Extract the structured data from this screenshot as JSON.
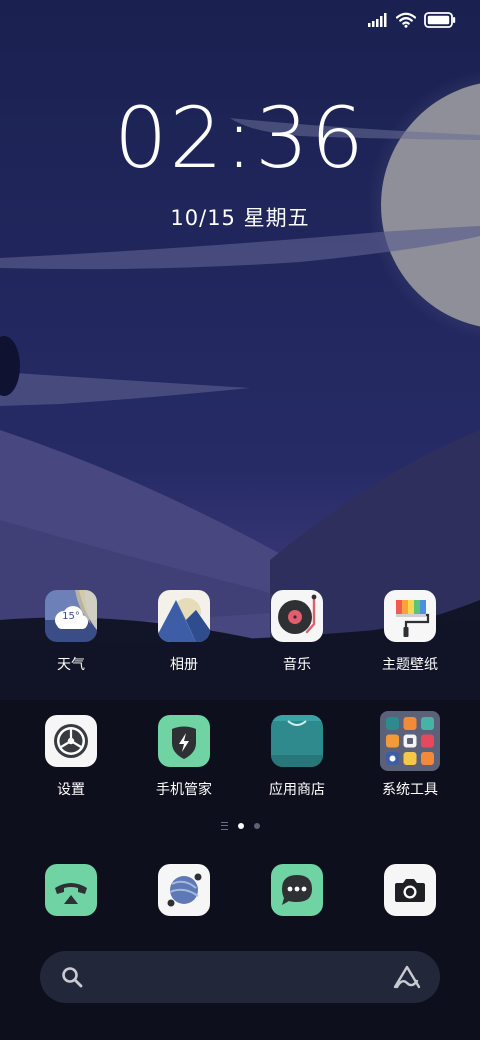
{
  "status_bar": {
    "signal_icon": "signal-bars-icon",
    "wifi_icon": "wifi-icon",
    "battery_icon": "battery-icon"
  },
  "clock": {
    "time": "02:36",
    "date": "10/15 星期五"
  },
  "home_apps": [
    {
      "label": "天气",
      "icon": "weather-icon",
      "temp": "15°"
    },
    {
      "label": "相册",
      "icon": "gallery-icon"
    },
    {
      "label": "音乐",
      "icon": "music-icon"
    },
    {
      "label": "主题壁纸",
      "icon": "theme-wallpaper-icon"
    },
    {
      "label": "设置",
      "icon": "settings-icon"
    },
    {
      "label": "手机管家",
      "icon": "phone-manager-icon"
    },
    {
      "label": "应用商店",
      "icon": "app-store-icon"
    },
    {
      "label": "系统工具",
      "icon": "system-tools-folder-icon"
    }
  ],
  "pager": {
    "pages": 2,
    "active_page": 1
  },
  "dock": [
    {
      "icon": "phone-icon"
    },
    {
      "icon": "browser-icon"
    },
    {
      "icon": "messages-icon"
    },
    {
      "icon": "camera-icon"
    }
  ],
  "search": {
    "search_icon": "search-icon",
    "assistant_icon": "assistant-logo-icon"
  },
  "colors": {
    "sky_top": "#1a2150",
    "sky_bottom": "#3c3a78",
    "moon": "#8e8f98",
    "dock_green": "#6fd3a3",
    "store_teal": "#2e8a8d",
    "search_bg": "#22273a"
  }
}
